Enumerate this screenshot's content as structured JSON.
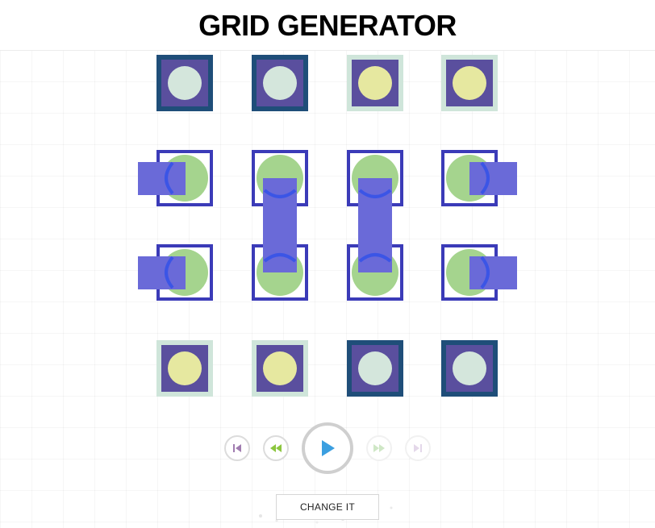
{
  "header": {
    "title": "GRID GENERATOR"
  },
  "colors": {
    "tile_dark_border": "#1f4e79",
    "tile_light_border": "#cfe5da",
    "tile_fill": "#5a4f9e",
    "circle_pale": "#d4e6dc",
    "circle_yellow": "#e6e8a0",
    "ring_blue": "#3b3bb8",
    "circle_green": "#a5d48e",
    "connector": "#6a6ad8",
    "arc_blue": "#3b55e6",
    "play_blue": "#3b9fe0",
    "rewind_green": "#8cc63f",
    "skip_purple": "#a07cb0"
  },
  "controls": {
    "skip_back": {
      "icon": "skip-back-icon",
      "enabled": true
    },
    "rewind": {
      "icon": "rewind-icon",
      "enabled": true
    },
    "play": {
      "icon": "play-icon",
      "enabled": true
    },
    "fast_forward": {
      "icon": "fast-forward-icon",
      "enabled": false
    },
    "skip_forward": {
      "icon": "skip-forward-icon",
      "enabled": false
    }
  },
  "change_button": {
    "label": "CHANGE IT"
  }
}
